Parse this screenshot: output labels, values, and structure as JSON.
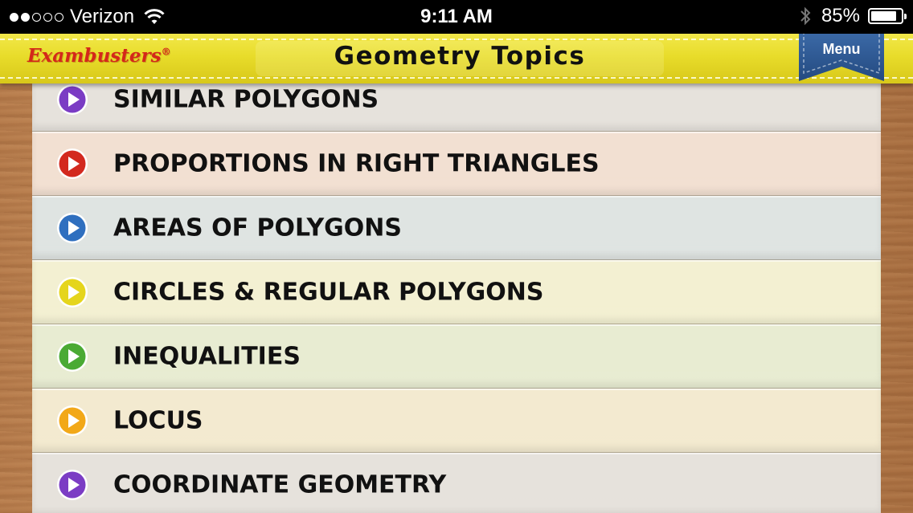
{
  "status_bar": {
    "carrier": "Verizon",
    "signal_bars_filled": 2,
    "signal_bars_total": 5,
    "wifi_icon": "wifi-icon",
    "time": "9:11 AM",
    "bluetooth_icon": "bluetooth-icon",
    "battery_percent": "85%",
    "battery_level": 0.85
  },
  "header": {
    "brand": "Exambusters",
    "brand_mark": "®",
    "title": "Geometry Topics",
    "menu_label": "Menu",
    "colors": {
      "bar": "#e8dc2a",
      "brand": "#d4281a",
      "menu_ribbon": "#2d5a96"
    }
  },
  "topics": [
    {
      "label": "SIMILAR POLYGONS",
      "icon": "play-icon",
      "icon_color": "#7b3cc4",
      "row_color": "#e6e2dc"
    },
    {
      "label": "PROPORTIONS IN RIGHT TRIANGLES",
      "icon": "play-icon",
      "icon_color": "#d3291f",
      "row_color": "#f2e0d2"
    },
    {
      "label": "AREAS OF POLYGONS",
      "icon": "play-icon",
      "icon_color": "#2f6fbf",
      "row_color": "#dfe4e2"
    },
    {
      "label": "CIRCLES & REGULAR POLYGONS",
      "icon": "play-icon",
      "icon_color": "#e5d51c",
      "row_color": "#f3f0d2"
    },
    {
      "label": "INEQUALITIES",
      "icon": "play-icon",
      "icon_color": "#4aaa34",
      "row_color": "#e8ecd2"
    },
    {
      "label": "LOCUS",
      "icon": "play-icon",
      "icon_color": "#f2a818",
      "row_color": "#f3ead0"
    },
    {
      "label": "COORDINATE GEOMETRY",
      "icon": "play-icon",
      "icon_color": "#7b3cc4",
      "row_color": "#e6e2dc"
    }
  ]
}
